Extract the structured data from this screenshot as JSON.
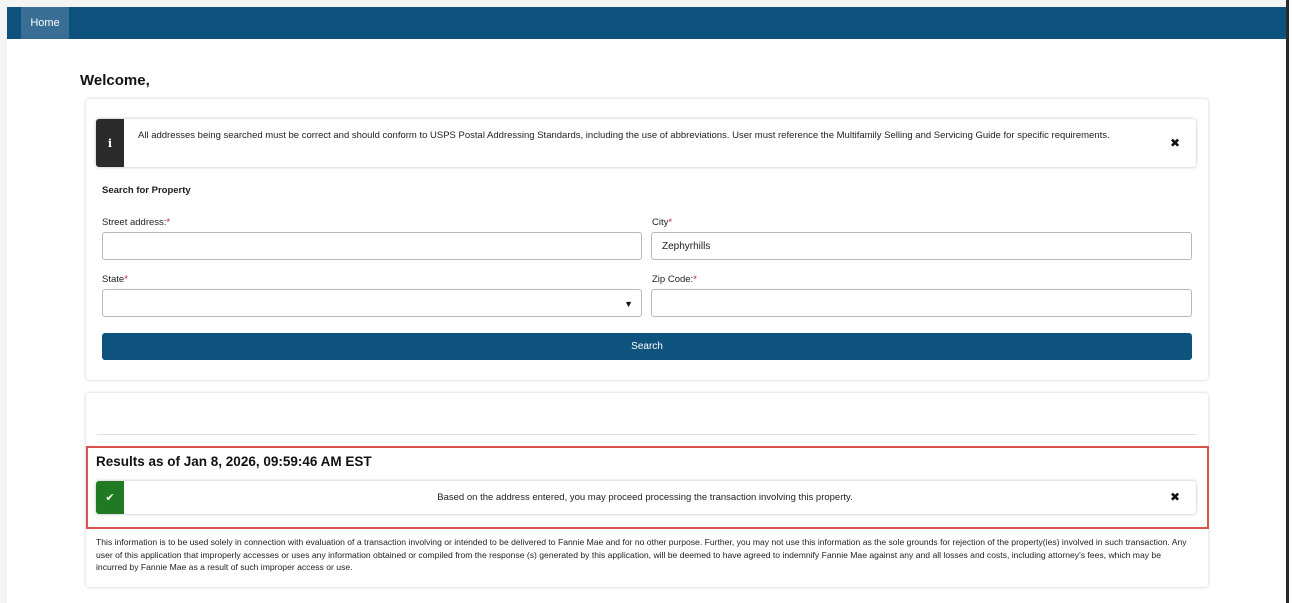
{
  "nav": {
    "home_label": "Home"
  },
  "welcome_text": "Welcome,",
  "info_alert": {
    "icon": "info-icon",
    "text": "All addresses being searched must be correct and should conform to USPS Postal Addressing Standards, including the use of abbreviations. User must reference the Multifamily Selling and Servicing Guide for specific requirements.",
    "close_glyph": "✖"
  },
  "search_form": {
    "heading": "Search for Property",
    "street": {
      "label": "Street address:",
      "required_mark": "*",
      "value": "",
      "placeholder": ""
    },
    "city": {
      "label": "City",
      "required_mark": "*",
      "value": "Zephyrhills"
    },
    "state": {
      "label": "State",
      "required_mark": "*",
      "selected": ""
    },
    "zip": {
      "label": "Zip Code:",
      "required_mark": "*",
      "value": ""
    },
    "search_button": "Search"
  },
  "results": {
    "title": "Results as of Jan 8, 2026, 09:59:46 AM EST",
    "success_alert": {
      "icon": "check-icon",
      "text": "Based on the address entered, you may proceed processing the transaction involving this property.",
      "close_glyph": "✖"
    },
    "disclaimer": "This information is to be used solely in connection with evaluation of a transaction involving or intended to be delivered to Fannie Mae and for no other purpose. Further, you may not use this information as the sole grounds for rejection of the property(ies) involved in such transaction. Any user of this application that improperly accesses or uses any information obtained or compiled from the response (s) generated by this application, will be deemed to have agreed to indemnify Fannie Mae against any and all losses and costs, including attorney's fees, which may be incurred by Fannie Mae as a result of such improper access or use."
  },
  "colors": {
    "navbar": "#0e527e",
    "primary_button": "#0e527e",
    "success": "#1f7a23",
    "info_icon_bg": "#2b2b2b",
    "required": "#c0182a",
    "highlight_border": "#d9534f"
  }
}
